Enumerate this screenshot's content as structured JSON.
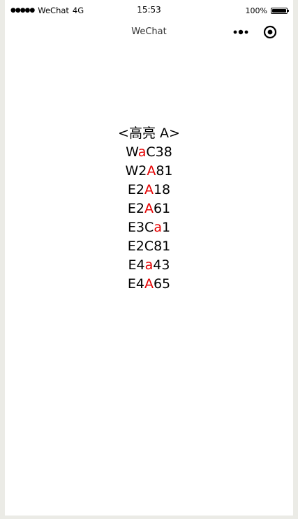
{
  "status_bar": {
    "signal_dots": "●●●●●",
    "carrier": "WeChat",
    "network": "4G",
    "time": "15:53",
    "battery_percent": "100%",
    "battery_level": 1.0
  },
  "nav": {
    "title": "WeChat",
    "more_icon": "more-dots-icon",
    "close_icon": "target-circle-icon"
  },
  "content": {
    "highlight_color": "#e60000",
    "lines": [
      {
        "pre": "<高亮 A>",
        "hl": "",
        "post": ""
      },
      {
        "pre": "W",
        "hl": "a",
        "post": "C38"
      },
      {
        "pre": "W2",
        "hl": "A",
        "post": "81"
      },
      {
        "pre": "E2",
        "hl": "A",
        "post": "18"
      },
      {
        "pre": "E2",
        "hl": "A",
        "post": "61"
      },
      {
        "pre": "E3C",
        "hl": "a",
        "post": "1"
      },
      {
        "pre": "E2C81",
        "hl": "",
        "post": ""
      },
      {
        "pre": "E4",
        "hl": "a",
        "post": "43"
      },
      {
        "pre": "E4",
        "hl": "A",
        "post": "65"
      }
    ]
  }
}
